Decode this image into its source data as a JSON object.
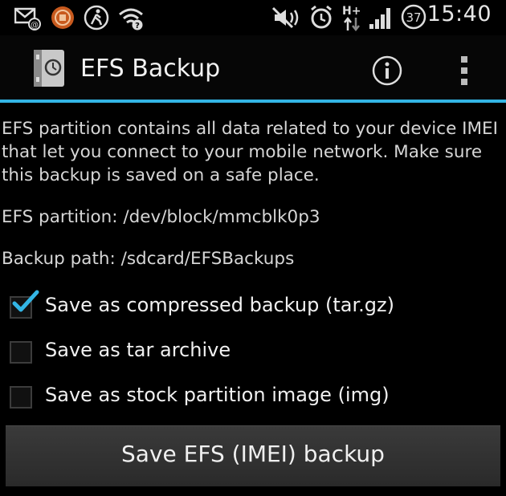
{
  "status_bar": {
    "time": "15:40",
    "battery_level": "37",
    "network_type": "H+",
    "icons": [
      "email-notification-icon",
      "app-notification-icon",
      "walk-icon",
      "wifi-question-icon",
      "mute-icon",
      "alarm-icon",
      "network-arrows-icon",
      "signal-icon",
      "battery-icon"
    ]
  },
  "action_bar": {
    "title": "EFS Backup",
    "accent_color": "#33b5e5",
    "icons": [
      "app-icon",
      "info-icon",
      "overflow-menu-icon"
    ]
  },
  "content": {
    "description": "EFS partition contains all data related to your device IMEI that let you connect to your mobile network. Make sure this backup is saved on a safe place.",
    "efs_partition": "EFS partition: /dev/block/mmcblk0p3",
    "backup_path": "Backup path: /sdcard/EFSBackups"
  },
  "options": [
    {
      "label": "Save as compressed backup (tar.gz)",
      "checked": true
    },
    {
      "label": "Save as tar archive",
      "checked": false
    },
    {
      "label": "Save as stock partition image (img)",
      "checked": false
    }
  ],
  "save_button": {
    "label": "Save EFS (IMEI) backup"
  }
}
